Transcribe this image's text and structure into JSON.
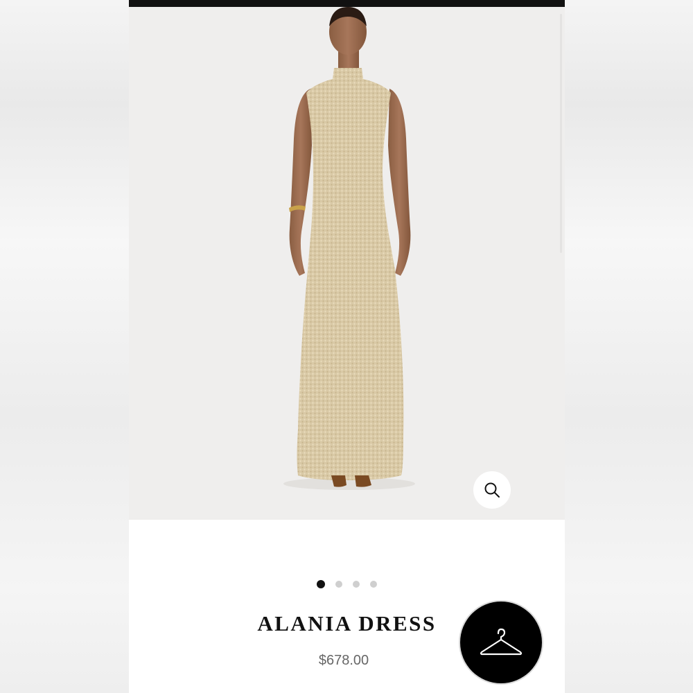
{
  "product": {
    "name": "ALANIA DRESS",
    "price": "$678.00"
  },
  "gallery": {
    "image_count": 4,
    "active_index": 0
  },
  "icons": {
    "zoom": "magnifier-icon",
    "wishlist": "hanger-icon"
  },
  "colors": {
    "top_bar": "#111111",
    "hero_background": "#efeeed",
    "dress": "#d9c7a3",
    "dot_active": "#111111",
    "dot_inactive": "#cfcfcf",
    "price_text": "#666666",
    "hanger_button": "#000000"
  }
}
